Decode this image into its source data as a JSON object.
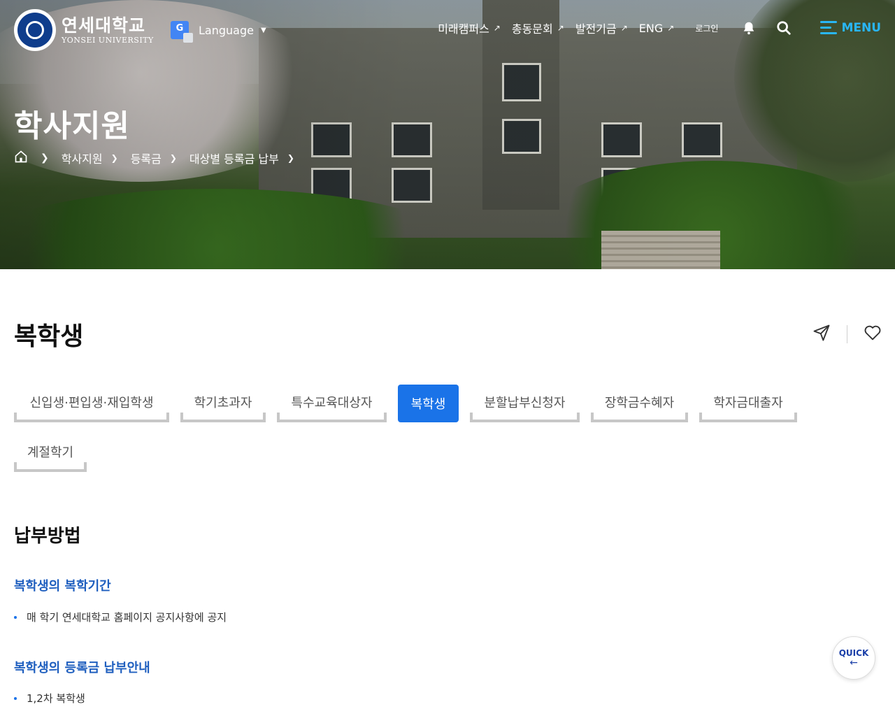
{
  "header": {
    "logo": {
      "ko": "연세대학교",
      "en": "YONSEI UNIVERSITY"
    },
    "language_label": "Language",
    "top_links": [
      {
        "label": "미래캠퍼스"
      },
      {
        "label": "총동문회"
      },
      {
        "label": "발전기금"
      },
      {
        "label": "ENG"
      }
    ],
    "login_label": "로그인",
    "menu_label": "MENU",
    "accent_color": "#29b6f6"
  },
  "hero": {
    "title": "학사지원",
    "breadcrumb": [
      "학사지원",
      "등록금",
      "대상별 등록금 납부"
    ]
  },
  "page": {
    "title": "복학생",
    "tabs": [
      {
        "label": "신입생·편입생·재입학생",
        "active": false
      },
      {
        "label": "학기초과자",
        "active": false
      },
      {
        "label": "특수교육대상자",
        "active": false
      },
      {
        "label": "복학생",
        "active": true
      },
      {
        "label": "분할납부신청자",
        "active": false
      },
      {
        "label": "장학금수혜자",
        "active": false
      },
      {
        "label": "학자금대출자",
        "active": false
      },
      {
        "label": "계절학기",
        "active": false
      }
    ],
    "active_tab_color": "#1a73e8"
  },
  "content": {
    "section_title": "납부방법",
    "blocks": [
      {
        "subtitle": "복학생의 복학기간",
        "items": [
          "매 학기 연세대학교 홈페이지 공지사항에 공지"
        ]
      },
      {
        "subtitle": "복학생의 등록금 납부안내",
        "items": [
          "1,2차 복학생"
        ]
      }
    ]
  },
  "quick": {
    "label": "QUICK",
    "arrow": "←"
  }
}
